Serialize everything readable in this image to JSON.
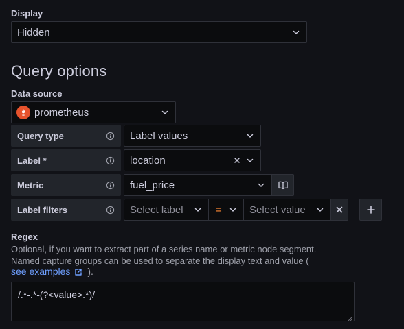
{
  "display": {
    "label": "Display",
    "value": "Hidden"
  },
  "query_options": {
    "heading": "Query options",
    "data_source_label": "Data source",
    "data_source_value": "prometheus",
    "rows": {
      "query_type": {
        "label": "Query type",
        "value": "Label values"
      },
      "label": {
        "label": "Label *",
        "value": "location"
      },
      "metric": {
        "label": "Metric",
        "value": "fuel_price"
      },
      "label_filters": {
        "label": "Label filters",
        "label_placeholder": "Select label",
        "operator": "=",
        "value_placeholder": "Select value"
      }
    }
  },
  "regex": {
    "label": "Regex",
    "description_line1": "Optional, if you want to extract part of a series name or metric node segment.",
    "description_line2": "Named capture groups can be used to separate the display text and value (",
    "link_text": "see examples",
    "description_end": ").",
    "value": "/.*-.*-(?<value>.*)/"
  },
  "colors": {
    "background": "#111217",
    "input_bg": "#0b0c0e",
    "label_bg": "#22252b",
    "border": "#2f3139",
    "link": "#6e9fff",
    "operator": "#ff8833",
    "prometheus": "#e6522c"
  },
  "icons": {
    "chevron": "chevron-down-icon",
    "info": "info-circle-icon",
    "clear": "close-icon",
    "book": "book-open-icon",
    "add": "plus-icon",
    "external": "external-link-icon",
    "resize": "resize-handle-icon",
    "datasource": "prometheus-logo-icon"
  }
}
